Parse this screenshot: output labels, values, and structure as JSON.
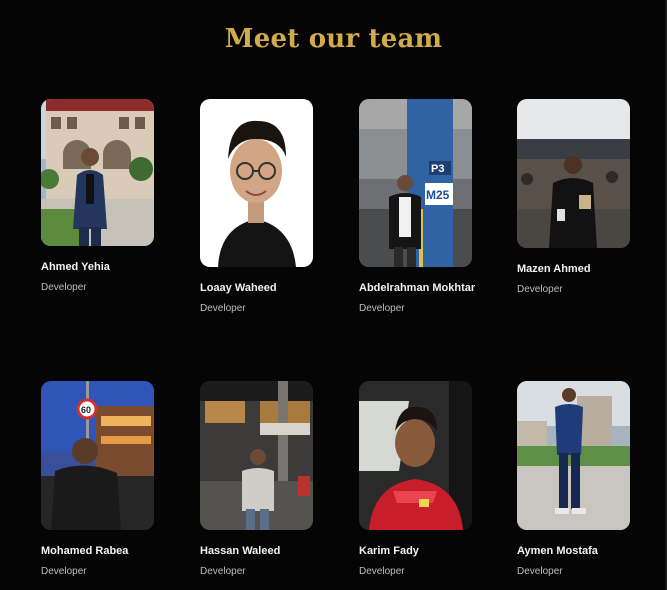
{
  "title": "Meet our team",
  "colors": {
    "accent": "#d2ac4c",
    "background": "#050505"
  },
  "team": [
    {
      "name": "Ahmed Yehia",
      "role": "Developer"
    },
    {
      "name": "Loaay Waheed",
      "role": "Developer"
    },
    {
      "name": "Abdelrahman Mokhtar",
      "role": "Developer",
      "photo_sign_1": "P3",
      "photo_sign_2": "M25"
    },
    {
      "name": "Mazen Ahmed",
      "role": "Developer"
    },
    {
      "name": "Mohamed Rabea",
      "role": "Developer",
      "photo_sign_1": "60"
    },
    {
      "name": "Hassan Waleed",
      "role": "Developer"
    },
    {
      "name": "Karim Fady",
      "role": "Developer"
    },
    {
      "name": "Aymen Mostafa",
      "role": "Developer"
    }
  ]
}
